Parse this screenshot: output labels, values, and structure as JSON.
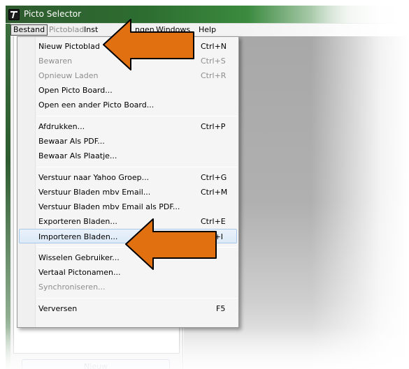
{
  "window": {
    "title": "Picto Selector",
    "icon": "picto-selector-app-icon"
  },
  "menubar": {
    "items": [
      {
        "label": "Bestand",
        "state": "open"
      },
      {
        "label": "Pictoblad",
        "state": "disabled"
      },
      {
        "label": "Inst",
        "state": "normal"
      },
      {
        "label": "ngen",
        "state": "normal"
      },
      {
        "label": "Windows",
        "state": "normal"
      },
      {
        "label": "Help",
        "state": "normal"
      }
    ]
  },
  "file_menu": {
    "items": [
      {
        "label": "Nieuw Pictoblad",
        "shortcut": "Ctrl+N",
        "disabled": false
      },
      {
        "label": "Bewaren",
        "shortcut": "Ctrl+S",
        "disabled": true
      },
      {
        "label": "Opnieuw Laden",
        "shortcut": "Ctrl+R",
        "disabled": true
      },
      {
        "label": "Open Picto Board...",
        "shortcut": "",
        "disabled": false
      },
      {
        "label": "Open een ander Picto Board...",
        "shortcut": "",
        "disabled": false
      },
      {
        "label": "Afdrukken...",
        "shortcut": "Ctrl+P",
        "disabled": false
      },
      {
        "label": "Bewaar Als PDF...",
        "shortcut": "",
        "disabled": false
      },
      {
        "label": "Bewaar Als Plaatje...",
        "shortcut": "",
        "disabled": false
      },
      {
        "label": "Verstuur naar Yahoo Groep...",
        "shortcut": "Ctrl+G",
        "disabled": false
      },
      {
        "label": "Verstuur Bladen mbv Email...",
        "shortcut": "Ctrl+M",
        "disabled": false
      },
      {
        "label": "Verstuur Bladen mbv Email als PDF...",
        "shortcut": "",
        "disabled": false
      },
      {
        "label": "Exporteren Bladen...",
        "shortcut": "Ctrl+E",
        "disabled": false
      },
      {
        "label": "Importeren Bladen...",
        "shortcut": "Ctrl+I",
        "disabled": false,
        "highlighted": true
      },
      {
        "label": "Wisselen Gebruiker...",
        "shortcut": "",
        "disabled": false
      },
      {
        "label": "Vertaal Pictonamen...",
        "shortcut": "",
        "disabled": false
      },
      {
        "label": "Synchroniseren...",
        "shortcut": "",
        "disabled": true
      },
      {
        "label": "Verversen",
        "shortcut": "F5",
        "disabled": false
      }
    ]
  },
  "left_panel": {
    "new_button_label": "Nieuw"
  },
  "colors": {
    "annotation_arrow": "#e07010",
    "title_bar_green": "#2d6e30",
    "menu_highlight": "#dce9f8"
  }
}
